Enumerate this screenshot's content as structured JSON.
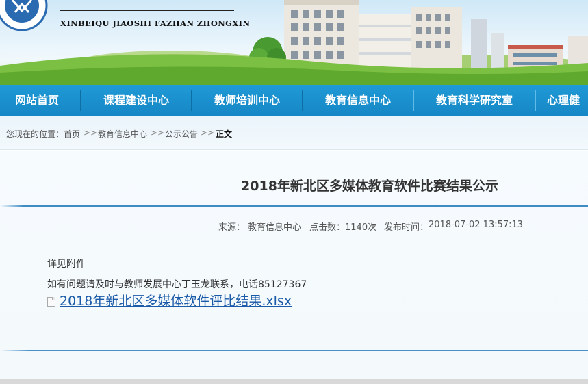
{
  "site": {
    "logo_subtitle": "XINBEIQU JIAOSHI FAZHAN ZHONGXIN"
  },
  "nav": {
    "items": [
      "网站首页",
      "课程建设中心",
      "教师培训中心",
      "教育信息中心",
      "教育科学研究室",
      "心理健"
    ]
  },
  "breadcrumb": {
    "prefix": "您现在的位置：",
    "items": [
      "首页",
      "教育信息中心",
      "公示公告"
    ],
    "separator": ">>",
    "current": "正文"
  },
  "article": {
    "title": "2018年新北区多媒体教育软件比赛结果公示",
    "source_label": "来源：",
    "source": "教育信息中心",
    "hits_label": "点击数：",
    "hits": "1140次",
    "date_label": "发布时间：",
    "date": "2018-07-02 13:57:13",
    "body": [
      "详见附件",
      "如有问题请及时与教师发展中心丁玉龙联系，电话85127367"
    ],
    "attachment": "2018年新北区多媒体软件评比结果.xlsx"
  },
  "colors": {
    "nav_bg": "#1686c5",
    "link": "#1a5aa8",
    "rule": "#3f8bc4"
  }
}
